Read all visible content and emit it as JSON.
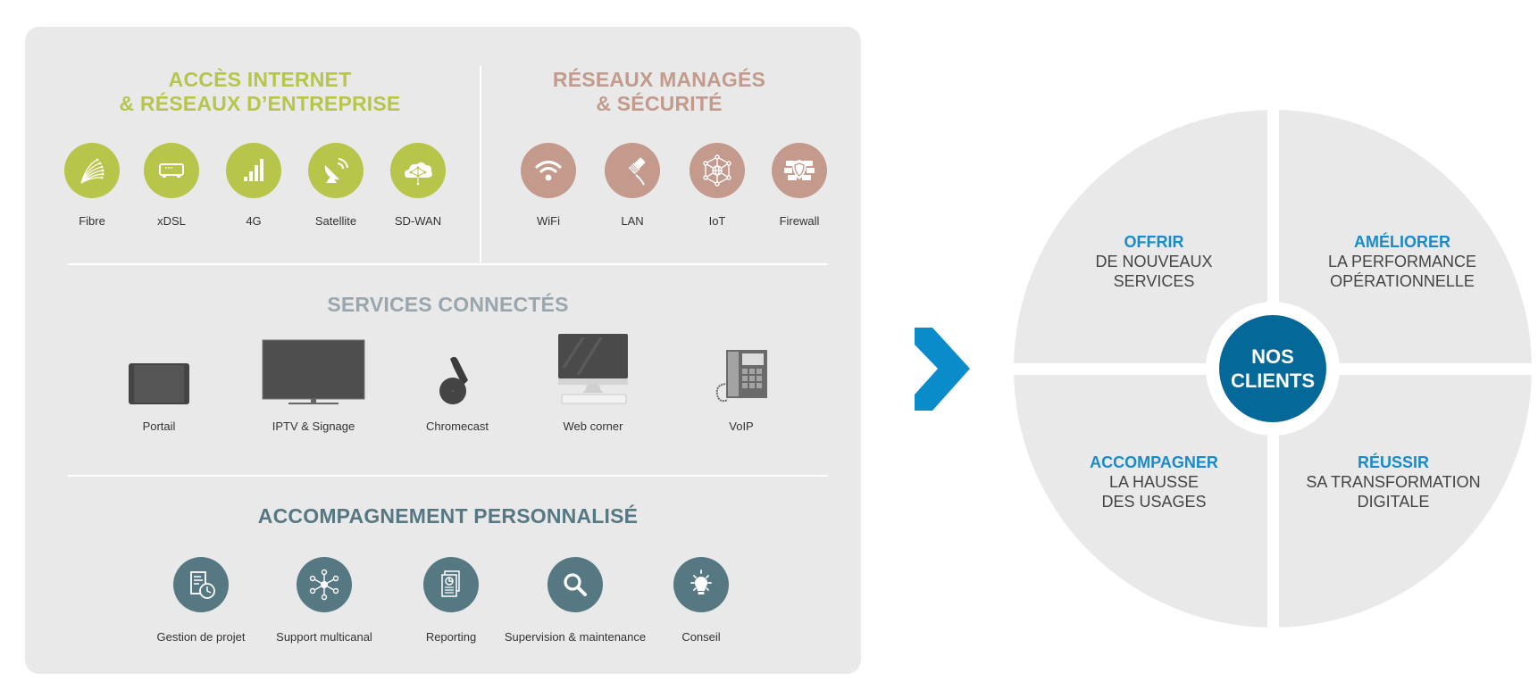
{
  "colors": {
    "panel_bg": "#e9e9e9",
    "green": "#b8c54b",
    "rose": "#c39a8c",
    "slate_title": "#9aa6ad",
    "teal": "#567882",
    "arrow_blue": "#0a8ccb",
    "quad_bg": "#e9e9e9",
    "badge_bg": "#046898",
    "quad_heading": "#1a8ac8"
  },
  "sections": {
    "internet": {
      "title_line1": "ACCÈS INTERNET",
      "title_line2": "& RÉSEAUX D’ENTREPRISE",
      "items": [
        {
          "label": "Fibre",
          "icon": "fiber-optic-icon"
        },
        {
          "label": "xDSL",
          "icon": "modem-icon"
        },
        {
          "label": "4G",
          "icon": "signal-bars-icon"
        },
        {
          "label": "Satellite",
          "icon": "satellite-dish-icon"
        },
        {
          "label": "SD-WAN",
          "icon": "cloud-network-icon"
        }
      ]
    },
    "managed": {
      "title_line1": "RÉSEAUX MANAGÉS",
      "title_line2": "& SÉCURITÉ",
      "items": [
        {
          "label": "WiFi",
          "icon": "wifi-icon"
        },
        {
          "label": "LAN",
          "icon": "ethernet-cable-icon"
        },
        {
          "label": "IoT",
          "icon": "iot-network-icon"
        },
        {
          "label": "Firewall",
          "icon": "firewall-shield-icon"
        }
      ]
    },
    "connected": {
      "title": "SERVICES CONNECTÉS",
      "items": [
        {
          "label": "Portail",
          "icon": "tablet-icon"
        },
        {
          "label": "IPTV & Signage",
          "icon": "tv-icon"
        },
        {
          "label": "Chromecast",
          "icon": "chromecast-icon"
        },
        {
          "label": "Web corner",
          "icon": "desktop-computer-icon"
        },
        {
          "label": "VoIP",
          "icon": "desk-phone-icon"
        }
      ]
    },
    "support": {
      "title": "ACCOMPAGNEMENT PERSONNALISÉ",
      "items": [
        {
          "label": "Gestion de projet",
          "icon": "document-clock-icon"
        },
        {
          "label": "Support multicanal",
          "icon": "hub-network-icon"
        },
        {
          "label": "Reporting",
          "icon": "report-chart-icon"
        },
        {
          "label": "Supervision & maintenance",
          "icon": "magnifier-icon"
        },
        {
          "label": "Conseil",
          "icon": "lightbulb-icon"
        }
      ]
    }
  },
  "arrow": {
    "icon": "chevron-right-icon"
  },
  "clients_wheel": {
    "center_line1": "NOS",
    "center_line2": "CLIENTS",
    "quadrants": [
      {
        "heading": "OFFRIR",
        "line1": "DE NOUVEAUX",
        "line2": "SERVICES"
      },
      {
        "heading": "AMÉLIORER",
        "line1": "LA PERFORMANCE",
        "line2": "OPÉRATIONNELLE"
      },
      {
        "heading": "ACCOMPAGNER",
        "line1": "LA HAUSSE",
        "line2": "DES USAGES"
      },
      {
        "heading": "RÉUSSIR",
        "line1": "SA TRANSFORMATION",
        "line2": "DIGITALE"
      }
    ]
  }
}
